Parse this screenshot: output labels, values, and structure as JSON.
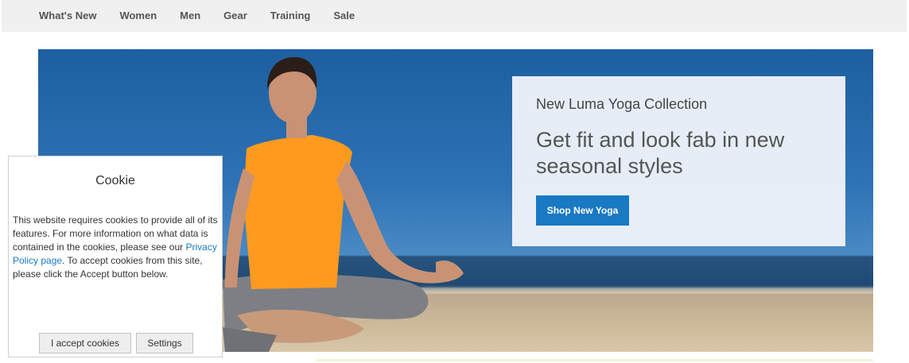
{
  "nav": {
    "items": [
      "What's New",
      "Women",
      "Men",
      "Gear",
      "Training",
      "Sale"
    ]
  },
  "hero": {
    "subtitle": "New Luma Yoga Collection",
    "headline": "Get fit and look fab in new seasonal styles",
    "button_label": "Shop New Yoga",
    "accent_color": "#1979c3"
  },
  "cookie": {
    "title": "Cookie",
    "text_before_link": "This website requires cookies to provide all of its features. For more information on what data is contained in the cookies, please see our ",
    "link_text": "Privacy Policy page",
    "text_after_link": ". To accept cookies from this site, please click the Accept button below.",
    "accept_label": "I accept cookies",
    "settings_label": "Settings"
  }
}
